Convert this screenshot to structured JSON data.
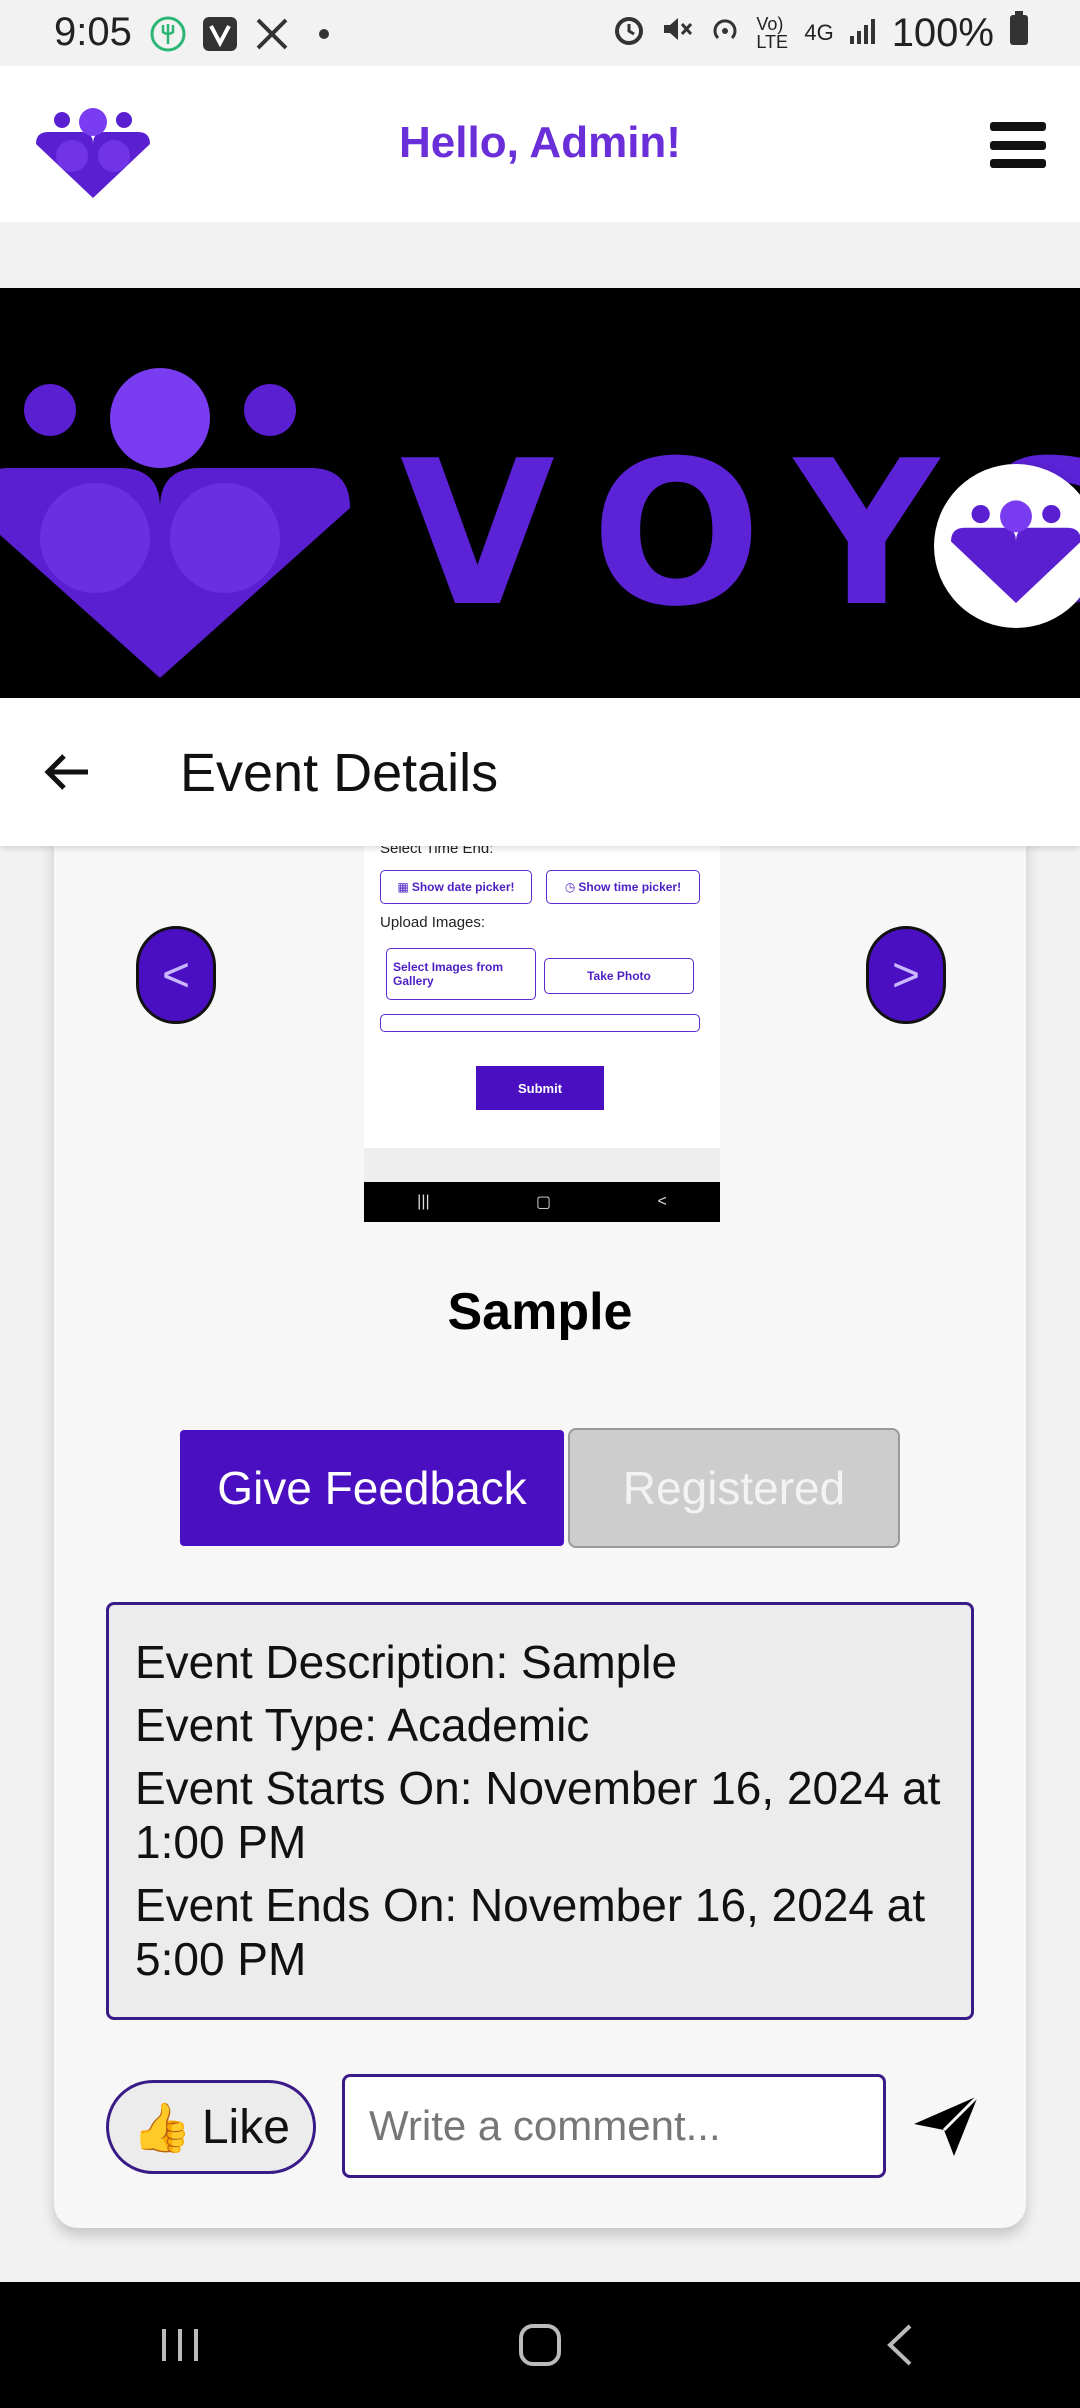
{
  "status_bar": {
    "time": "9:05",
    "battery": "100%",
    "net_label": "4G",
    "volte_label": "Vo) LTE"
  },
  "header": {
    "greeting": "Hello, Admin!"
  },
  "banner": {
    "brand": "VOYS"
  },
  "page": {
    "title": "Event Details"
  },
  "preview": {
    "select_time_end": "Select Time End:",
    "date_picker": "Show date picker!",
    "time_picker": "Show time picker!",
    "upload_images": "Upload Images:",
    "select_gallery": "Select Images from Gallery",
    "take_photo": "Take Photo",
    "submit": "Submit"
  },
  "carousel": {
    "prev": "<",
    "next": ">"
  },
  "event": {
    "name": "Sample",
    "description": "Event Description: Sample",
    "type": "Event Type: Academic",
    "starts": "Event Starts On: November 16, 2024 at 1:00 PM",
    "ends": "Event Ends On: November 16, 2024 at 5:00 PM"
  },
  "actions": {
    "feedback": "Give Feedback",
    "registered": "Registered",
    "like_emoji": "👍",
    "like": "Like",
    "comment_placeholder": "Write a comment..."
  },
  "colors": {
    "brand_purple": "#4a0fc0",
    "greeting_purple": "#6a2fd8"
  }
}
